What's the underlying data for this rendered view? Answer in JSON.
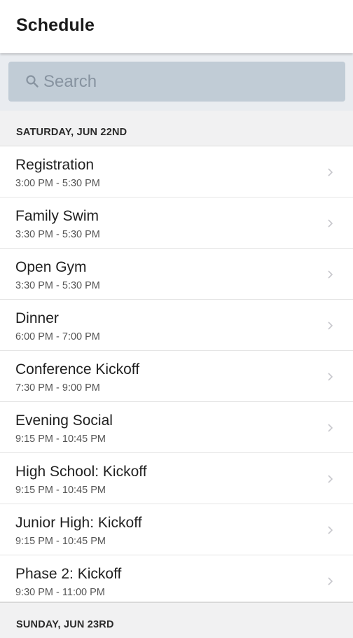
{
  "app_bar": {
    "title": "Schedule"
  },
  "search": {
    "placeholder": "Search",
    "value": ""
  },
  "sections": [
    {
      "label": "SATURDAY, JUN 22ND",
      "items": [
        {
          "title": "Registration",
          "time": "3:00 PM - 5:30 PM"
        },
        {
          "title": "Family Swim",
          "time": "3:30 PM - 5:30 PM"
        },
        {
          "title": "Open Gym",
          "time": "3:30 PM - 5:30 PM"
        },
        {
          "title": "Dinner",
          "time": "6:00 PM - 7:00 PM"
        },
        {
          "title": "Conference Kickoff",
          "time": "7:30 PM - 9:00 PM"
        },
        {
          "title": "Evening Social",
          "time": "9:15 PM - 10:45 PM"
        },
        {
          "title": "High School: Kickoff",
          "time": "9:15 PM - 10:45 PM"
        },
        {
          "title": "Junior High: Kickoff",
          "time": "9:15 PM - 10:45 PM"
        },
        {
          "title": "Phase 2: Kickoff",
          "time": "9:30 PM - 11:00 PM"
        }
      ]
    },
    {
      "label": "SUNDAY, JUN 23RD",
      "items": []
    }
  ],
  "icons": {
    "search": "search-icon",
    "chevron": "chevron-right-icon"
  },
  "colors": {
    "search_field": "#c1ccd6",
    "background": "#f1f1f2",
    "chevron": "#c7c7cc"
  }
}
